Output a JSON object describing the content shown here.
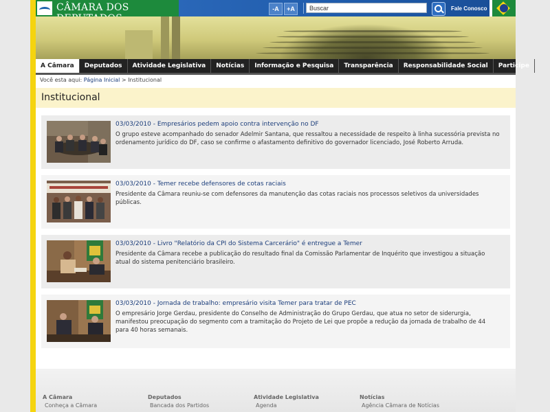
{
  "header": {
    "logo_text": "CÂMARA DOS DEPUTADOS",
    "font_decrease": "-A",
    "font_increase": "+A",
    "search_placeholder": "Buscar",
    "contact": "Fale Conosco",
    "colors": {
      "green": "#1d8a3c",
      "blue": "#1e5aa9",
      "yellow": "#f5d40f"
    }
  },
  "nav": {
    "items": [
      "A Câmara",
      "Deputados",
      "Atividade Legislativa",
      "Notícias",
      "Informação e Pesquisa",
      "Transparência",
      "Responsabilidade Social",
      "Participe"
    ],
    "active_index": 0
  },
  "breadcrumb": {
    "prefix": "Você esta aqui: ",
    "home": "Página Inicial",
    "sep": " > ",
    "current": "Institucional"
  },
  "page_title": "Institucional",
  "news": [
    {
      "headline": "03/03/2010 - Empresários pedem apoio contra intervenção no DF",
      "desc": "O grupo esteve acompanhado do senador Adelmir Santana, que ressaltou a necessidade de respeito à linha sucessória prevista no ordenamento jurídico do DF, caso se confirme o afastamento definitivo do governador licenciado, José Roberto Arruda."
    },
    {
      "headline": "03/03/2010 - Temer recebe defensores de cotas raciais",
      "desc": "Presidente da Câmara reuniu-se com defensores da manutenção das cotas raciais nos processos seletivos da universidades públicas."
    },
    {
      "headline": "03/03/2010 - Livro \"Relatório da CPI do Sistema Carcerário\" é entregue a Temer",
      "desc": "Presidente da Câmara recebe a publicação do resultado final da Comissão Parlamentar de Inquérito que investigou a situação atual do sistema penitenciário brasileiro."
    },
    {
      "headline": "03/03/2010 - Jornada de trabalho: empresário visita Temer para tratar de PEC",
      "desc": "O empresário Jorge Gerdau, presidente do Conselho de Administração do Grupo Gerdau, que atua no setor de siderurgia, manifestou preocupação do segmento com a tramitação do Projeto de Lei que propõe a redução da jornada de trabalho de 44 para 40 horas semanais."
    }
  ],
  "footer": {
    "columns": [
      {
        "heading": "A Câmara",
        "link": "Conheça a Câmara"
      },
      {
        "heading": "Deputados",
        "link": "Bancada dos Partidos"
      },
      {
        "heading": "Atividade Legislativa",
        "link": "Agenda"
      },
      {
        "heading": "Notícias",
        "link": "Agência Câmara de Notícias"
      }
    ]
  }
}
